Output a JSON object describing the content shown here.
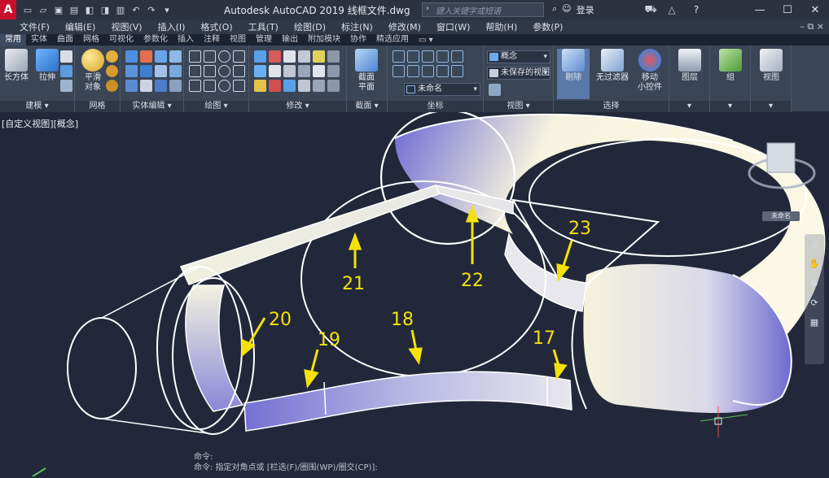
{
  "window": {
    "app_logo": "A",
    "title": "Autodesk AutoCAD 2019    线框文件.dwg",
    "search_placeholder": "键入关键字或短语",
    "login_label": "登录",
    "help_label": "?",
    "minimize": "—",
    "maximize": "☐",
    "close": "✕"
  },
  "menus": [
    "文件(F)",
    "编辑(E)",
    "视图(V)",
    "插入(I)",
    "格式(O)",
    "工具(T)",
    "绘图(D)",
    "标注(N)",
    "修改(M)",
    "窗口(W)",
    "帮助(H)",
    "参数(P)"
  ],
  "menu_right": "– ⧉ ×",
  "ribbon_tabs": [
    {
      "label": "常用",
      "active": true
    },
    {
      "label": "实体",
      "active": false
    },
    {
      "label": "曲面",
      "active": false
    },
    {
      "label": "网格",
      "active": false
    },
    {
      "label": "可视化",
      "active": false
    },
    {
      "label": "参数化",
      "active": false
    },
    {
      "label": "插入",
      "active": false
    },
    {
      "label": "注释",
      "active": false
    },
    {
      "label": "视图",
      "active": false
    },
    {
      "label": "管理",
      "active": false
    },
    {
      "label": "输出",
      "active": false
    },
    {
      "label": "附加模块",
      "active": false
    },
    {
      "label": "协作",
      "active": false
    },
    {
      "label": "精选应用",
      "active": false
    }
  ],
  "ribbon": {
    "box_label": "长方体",
    "extrude_label": "拉伸",
    "smooth_label": "平滑\n对象",
    "section_label": "截面\n平面",
    "visual_style_value": "概念",
    "saved_view_value": "未保存的视图",
    "ucs_value": "未命名",
    "isolate_label": "剔除",
    "filter_label": "无过滤器",
    "gizmo_label": "移动\n小控件",
    "layer_label": "图层",
    "group_label": "组",
    "view_label": "视图",
    "panel_titles": {
      "modeling": "建模 ▾",
      "mesh": "网格",
      "solid_edit": "实体编辑 ▾",
      "draw": "绘图 ▾",
      "modify": "修改 ▾",
      "section": "截面 ▾",
      "coords": "坐标",
      "view": "视图 ▾",
      "selection": "选择"
    }
  },
  "viewport": {
    "view_label": "[自定义视图][概念]",
    "viewcube_label": "未命名",
    "callouts": [
      "17",
      "18",
      "19",
      "20",
      "21",
      "22",
      "23"
    ],
    "command_lines": [
      "命令:",
      "命令: 指定对角点或 [栏选(F)/圈围(WP)/圈交(CP)]:"
    ]
  },
  "colors": {
    "title_bg": "#2b3340",
    "viewport_bg": "#222839",
    "callout": "#f3e10b",
    "surface_light": "#f4f2dc",
    "surface_blue": "#7a76d8",
    "edge": "#ffffff"
  }
}
